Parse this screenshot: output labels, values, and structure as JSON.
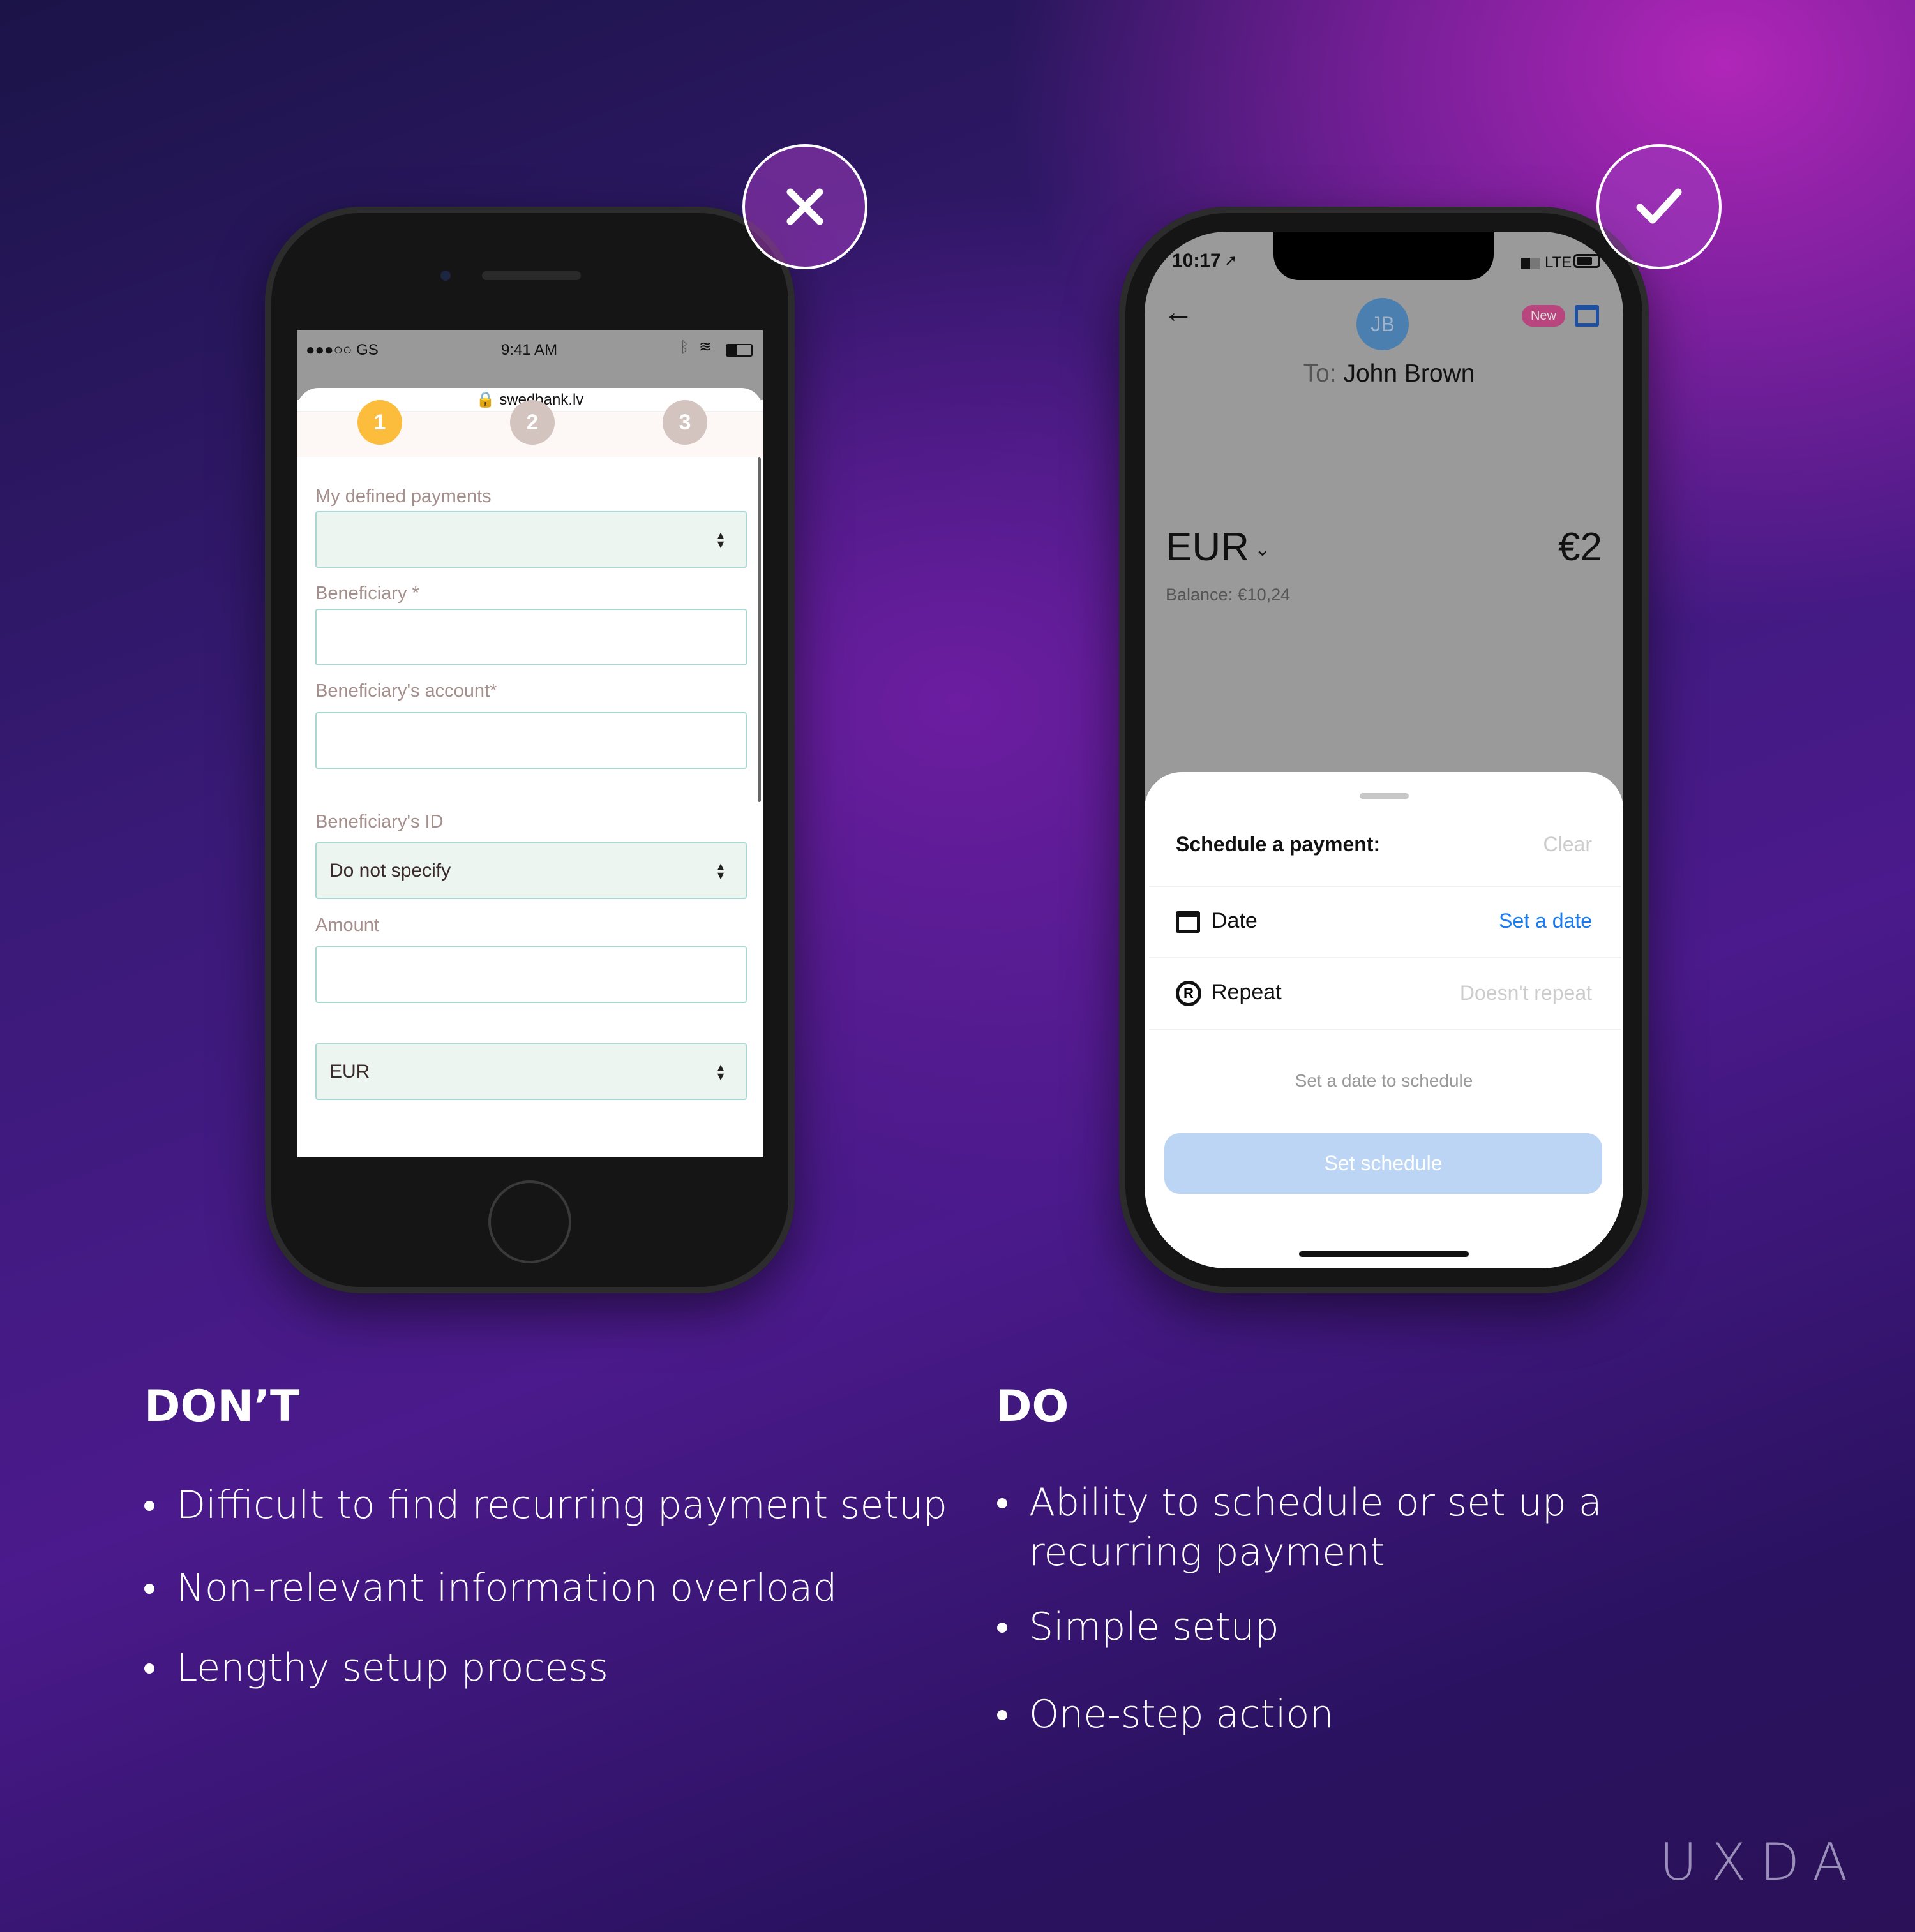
{
  "dont": {
    "heading": "DON’T",
    "bullets": [
      "Difficult to find recurring payment setup",
      "Non-relevant information overload",
      "Lengthy setup process"
    ],
    "phone": {
      "status": {
        "carrier": "●●●○○ GS",
        "time": "9:41 AM"
      },
      "url": "swedbank.lv",
      "steps": [
        "1",
        "2",
        "3"
      ],
      "fields": {
        "defined_payments_label": "My defined payments",
        "defined_payments_value": "",
        "beneficiary_label": "Beneficiary *",
        "account_label": "Beneficiary's account*",
        "id_label": "Beneficiary's ID",
        "id_value": "Do not specify",
        "amount_label": "Amount",
        "currency_value": "EUR"
      }
    }
  },
  "do": {
    "heading": "DO",
    "bullets": [
      "Ability to schedule or set up a recurring payment",
      "Simple setup",
      "One-step action"
    ],
    "phone": {
      "status": {
        "time": "10:17",
        "network": "LTE"
      },
      "avatar": "JB",
      "to_prefix": "To:",
      "recipient": "John Brown",
      "new_badge": "New",
      "currency": "EUR",
      "amount": "€2",
      "balance": "Balance: €10,24",
      "sheet": {
        "title": "Schedule a payment:",
        "clear": "Clear",
        "date_label": "Date",
        "date_value": "Set a date",
        "repeat_label": "Repeat",
        "repeat_value": "Doesn't repeat",
        "hint": "Set a date to schedule",
        "button": "Set schedule"
      }
    }
  },
  "logo": "UXDA",
  "colors": {
    "accent_blue": "#1a7cf2",
    "button_disabled": "#bcd5f5",
    "step_active": "#fbbd3b",
    "step_inactive": "#d4c4c0",
    "new_badge": "#b8457e",
    "avatar": "#4a7fb0"
  }
}
